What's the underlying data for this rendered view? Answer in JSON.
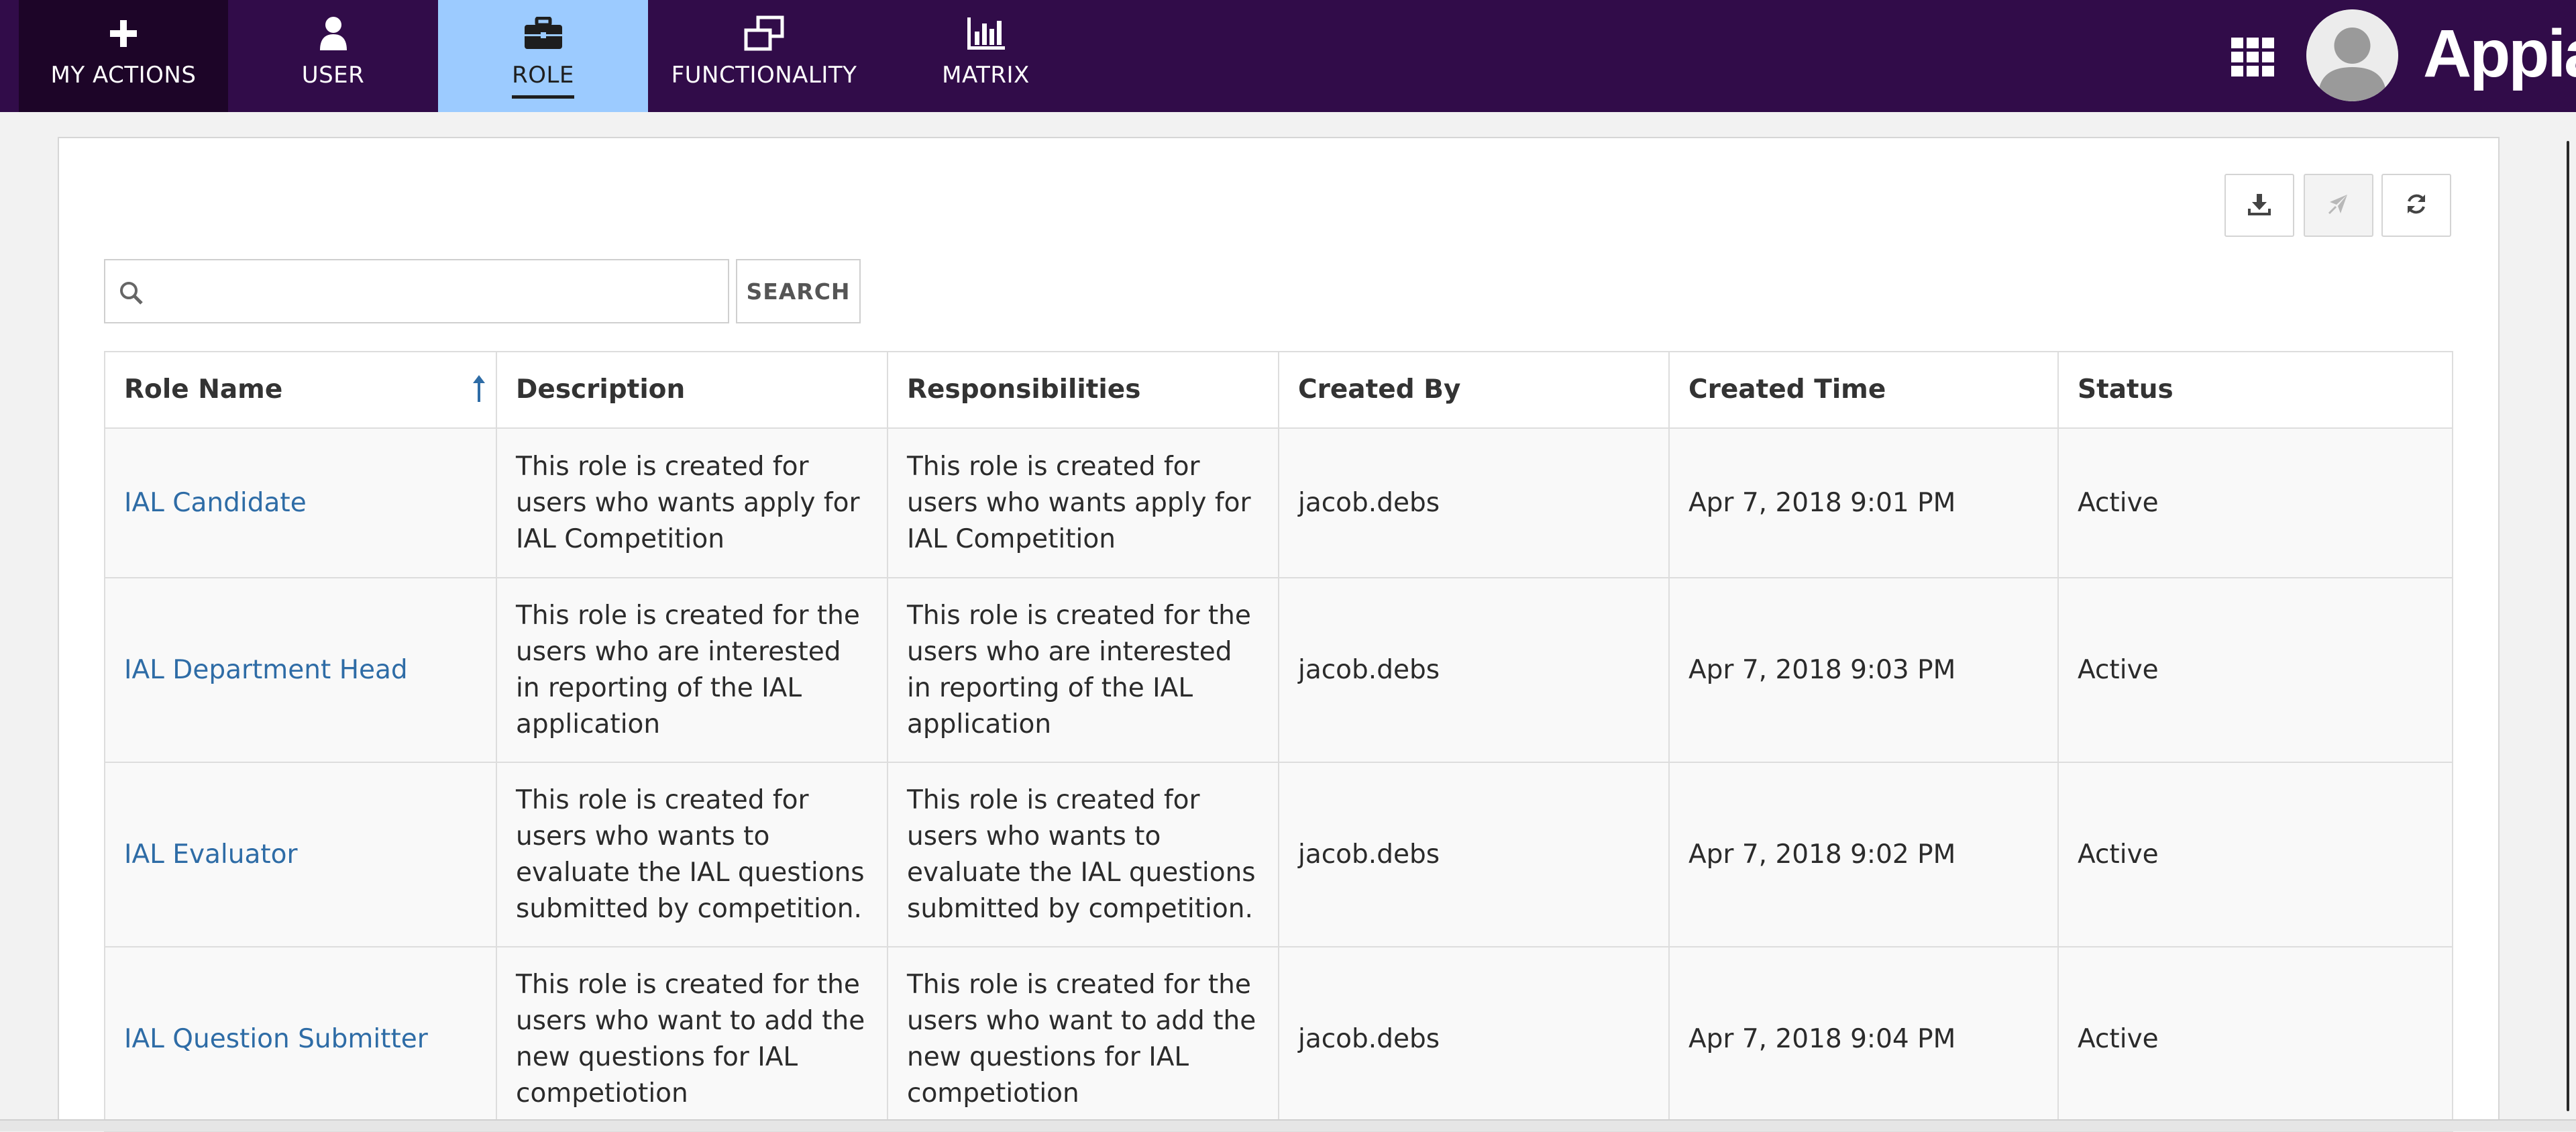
{
  "nav": {
    "tabs": [
      {
        "label": "MY ACTIONS",
        "icon": "plus-icon"
      },
      {
        "label": "USER",
        "icon": "user-icon"
      },
      {
        "label": "ROLE",
        "icon": "briefcase-icon"
      },
      {
        "label": "FUNCTIONALITY",
        "icon": "window-restore-icon"
      },
      {
        "label": "MATRIX",
        "icon": "bar-chart-icon"
      }
    ],
    "active_tab": "ROLE",
    "apps_icon": "grid-icon",
    "avatar_icon": "user-avatar-icon",
    "brand": "Appian"
  },
  "toolbar": {
    "download_icon": "download-icon",
    "disabled_icon": "paper-plane-icon",
    "refresh_icon": "refresh-icon"
  },
  "search": {
    "placeholder": "",
    "value": "",
    "button_label": "SEARCH"
  },
  "table": {
    "columns": [
      "Role Name",
      "Description",
      "Responsibilities",
      "Created By",
      "Created Time",
      "Status"
    ],
    "sort_column": "Role Name",
    "sort_direction": "ascending",
    "rows": [
      {
        "role_name": "IAL Candidate",
        "description": "This role is created for users who wants  apply for IAL Competition",
        "responsibilities": "This role is created for users who wants  apply for IAL Competition",
        "created_by": "jacob.debs",
        "created_time": "Apr 7, 2018 9:01 PM",
        "status": "Active"
      },
      {
        "role_name": "IAL Department Head",
        "description": "This role is created for the users who are interested in reporting of the IAL application",
        "responsibilities": "This role is created for the users who are interested in reporting of the IAL application",
        "created_by": "jacob.debs",
        "created_time": "Apr 7, 2018 9:03 PM",
        "status": "Active"
      },
      {
        "role_name": "IAL Evaluator",
        "description": "This role is created for users who wants to evaluate the IAL questions submitted by competition.",
        "responsibilities": "This role is created for users who wants to evaluate the IAL questions submitted by competition.",
        "created_by": "jacob.debs",
        "created_time": "Apr 7, 2018 9:02 PM",
        "status": "Active"
      },
      {
        "role_name": "IAL Question Submitter",
        "description": "This role is created for the users who want to add the new questions for IAL competiotion",
        "responsibilities": "This role is created for the users who want to add the new questions for IAL competiotion",
        "created_by": "jacob.debs",
        "created_time": "Apr 7, 2018 9:04 PM",
        "status": "Active"
      }
    ]
  },
  "colors": {
    "header_bg": "#310c49",
    "active_tab_bg": "#9ccbff",
    "link": "#2e6ca6"
  }
}
